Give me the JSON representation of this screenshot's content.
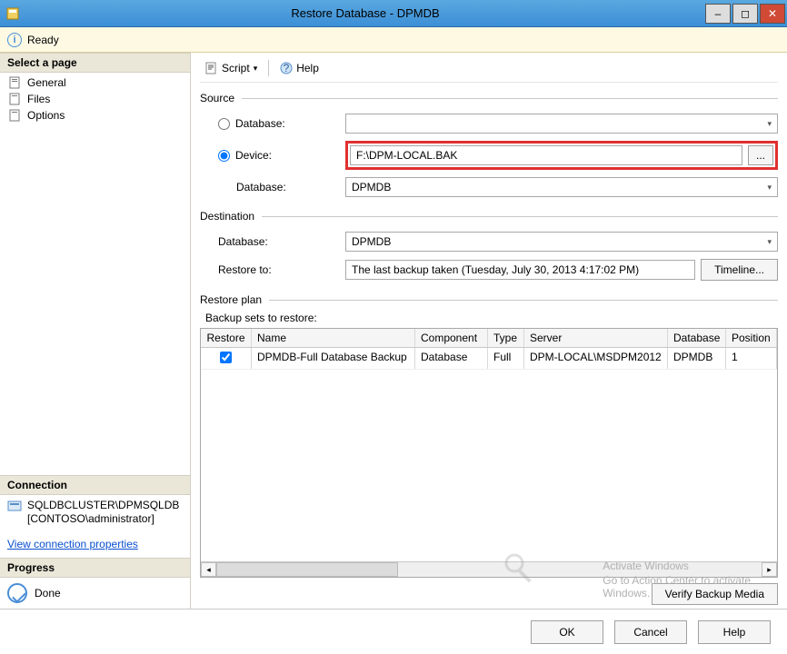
{
  "window": {
    "title": "Restore Database - DPMDB"
  },
  "readybar": {
    "text": "Ready"
  },
  "sidebar": {
    "select_page": "Select a page",
    "items": [
      "General",
      "Files",
      "Options"
    ],
    "connection_head": "Connection",
    "server": "SQLDBCLUSTER\\DPMSQLDB",
    "user": "[CONTOSO\\administrator]",
    "view_link": "View connection properties",
    "progress_head": "Progress",
    "progress_text": "Done"
  },
  "toolbar": {
    "script": "Script",
    "help": "Help"
  },
  "source": {
    "title": "Source",
    "db_radio": "Database:",
    "device_radio": "Device:",
    "device_path": "F:\\DPM-LOCAL.BAK",
    "browse": "...",
    "db_label": "Database:",
    "db_value": "DPMDB"
  },
  "dest": {
    "title": "Destination",
    "db_label": "Database:",
    "db_value": "DPMDB",
    "restore_to_label": "Restore to:",
    "restore_to_value": "The last backup taken (Tuesday, July 30, 2013 4:17:02 PM)",
    "timeline": "Timeline..."
  },
  "plan": {
    "title": "Restore plan",
    "sets_label": "Backup sets to restore:",
    "cols": {
      "restore": "Restore",
      "name": "Name",
      "component": "Component",
      "type": "Type",
      "server": "Server",
      "database": "Database",
      "position": "Position"
    },
    "rows": [
      {
        "checked": true,
        "name": "DPMDB-Full Database Backup",
        "component": "Database",
        "type": "Full",
        "server": "DPM-LOCAL\\MSDPM2012",
        "database": "DPMDB",
        "position": "1"
      }
    ],
    "verify": "Verify Backup Media"
  },
  "footer": {
    "ok": "OK",
    "cancel": "Cancel",
    "help": "Help"
  },
  "watermark": {
    "line1": "Activate Windows",
    "line2": "Go to Action Center to activate",
    "line3": "Windows."
  }
}
